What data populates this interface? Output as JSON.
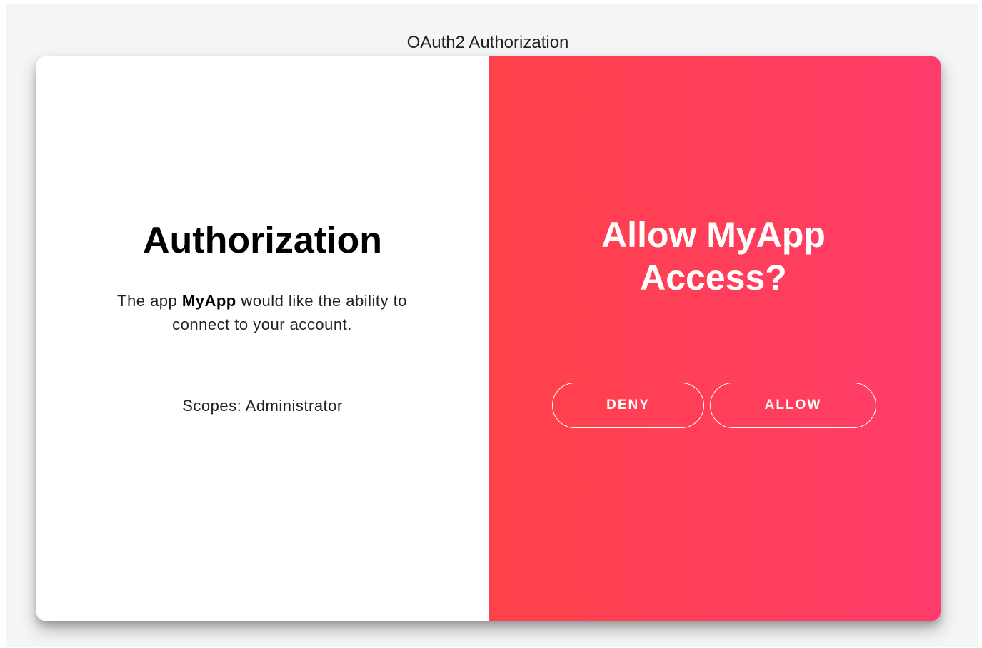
{
  "page": {
    "title": "OAuth2 Authorization"
  },
  "left_panel": {
    "heading": "Authorization",
    "description_prefix": "The app ",
    "app_name": "MyApp",
    "description_suffix": " would like the ability to connect to your account.",
    "scopes_text": "Scopes: Administrator"
  },
  "right_panel": {
    "heading": "Allow MyApp Access?",
    "deny_label": "DENY",
    "allow_label": "ALLOW",
    "gradient_start": "#ff4249",
    "gradient_end": "#ff3c6a"
  }
}
